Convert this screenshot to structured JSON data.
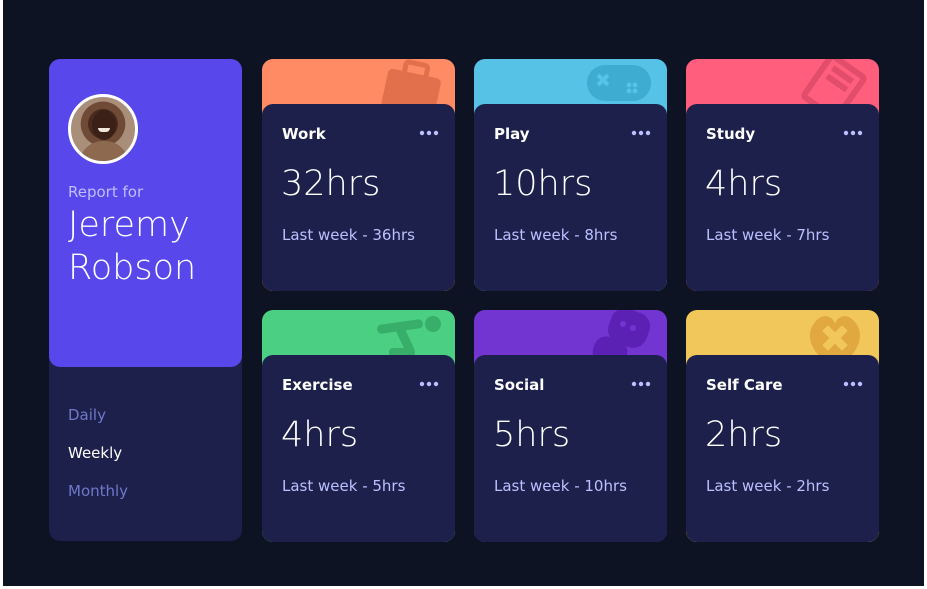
{
  "profile": {
    "report_for": "Report for",
    "first_name": "Jeremy",
    "last_name": "Robson",
    "timeframes": [
      {
        "label": "Daily",
        "active": false
      },
      {
        "label": "Weekly",
        "active": true
      },
      {
        "label": "Monthly",
        "active": false
      }
    ]
  },
  "cards": [
    {
      "title": "Work",
      "hours": "32hrs",
      "previous": "Last week - 36hrs",
      "color": "#ff8b64",
      "icon": "briefcase-icon"
    },
    {
      "title": "Play",
      "hours": "10hrs",
      "previous": "Last week - 8hrs",
      "color": "#55c2e6",
      "icon": "gamepad-icon"
    },
    {
      "title": "Study",
      "hours": "4hrs",
      "previous": "Last week - 7hrs",
      "color": "#ff5e7d",
      "icon": "book-icon"
    },
    {
      "title": "Exercise",
      "hours": "4hrs",
      "previous": "Last week - 5hrs",
      "color": "#4bcf82",
      "icon": "running-icon"
    },
    {
      "title": "Social",
      "hours": "5hrs",
      "previous": "Last week - 10hrs",
      "color": "#7335d2",
      "icon": "chat-icon"
    },
    {
      "title": "Self Care",
      "hours": "2hrs",
      "previous": "Last week - 2hrs",
      "color": "#f1c75b",
      "icon": "heart-care-icon"
    }
  ],
  "colors": {
    "background": "#0e1323",
    "card": "#1c204b",
    "profile_accent": "#5847eb",
    "muted_text": "#bbc0ff",
    "inactive_link": "#7078c9"
  }
}
